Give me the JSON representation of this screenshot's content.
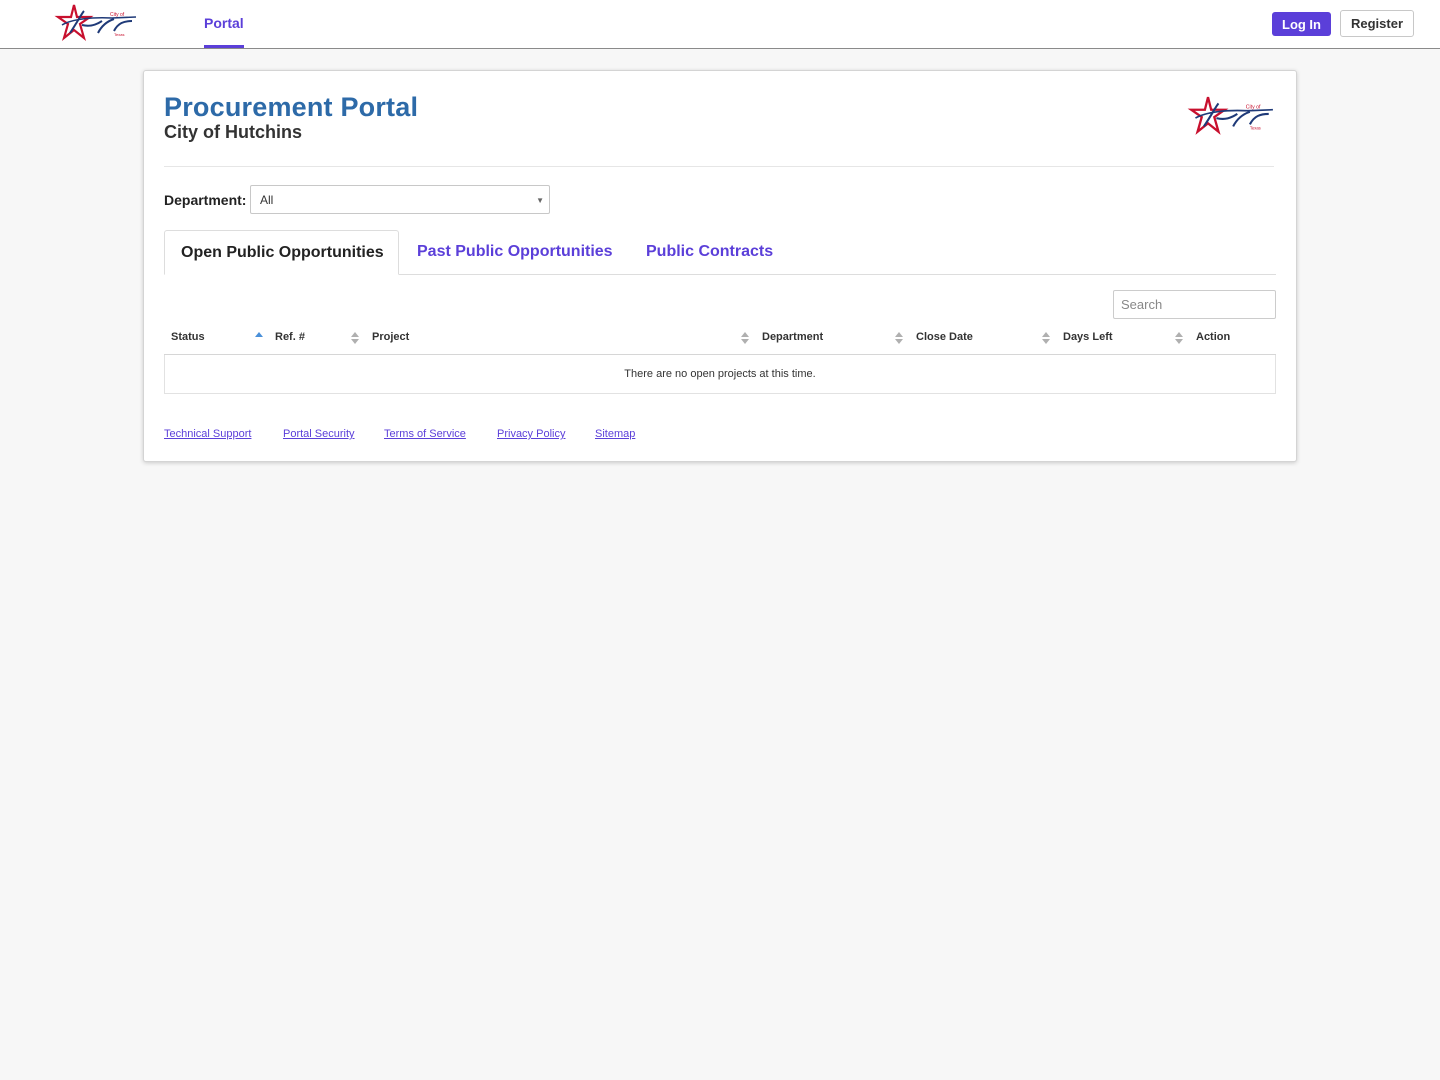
{
  "topbar": {
    "logo_icon": "city-of-hutchins-logo",
    "nav_portal": "Portal",
    "login_label": "Log In",
    "register_label": "Register"
  },
  "header": {
    "title": "Procurement Portal",
    "subtitle": "City of Hutchins",
    "logo_icon": "city-of-hutchins-logo"
  },
  "filter": {
    "label": "Department:",
    "value": "All"
  },
  "tabs": [
    {
      "label": "Open Public Opportunities",
      "active": true
    },
    {
      "label": "Past Public Opportunities",
      "active": false
    },
    {
      "label": "Public Contracts",
      "active": false
    }
  ],
  "search": {
    "placeholder": "Search"
  },
  "table": {
    "columns": [
      "Status",
      "Ref. #",
      "Project",
      "Department",
      "Close Date",
      "Days Left",
      "Action"
    ],
    "sorted_column": "Status",
    "sort_direction": "ascending",
    "empty_message": "There are no open projects at this time."
  },
  "footer": {
    "links": [
      "Technical Support",
      "Portal Security",
      "Terms of Service",
      "Privacy Policy",
      "Sitemap"
    ]
  },
  "colors": {
    "accent": "#5b3fd9",
    "title": "#2d6aa8",
    "logo_red": "#c8102e",
    "logo_blue": "#1f3a78"
  }
}
